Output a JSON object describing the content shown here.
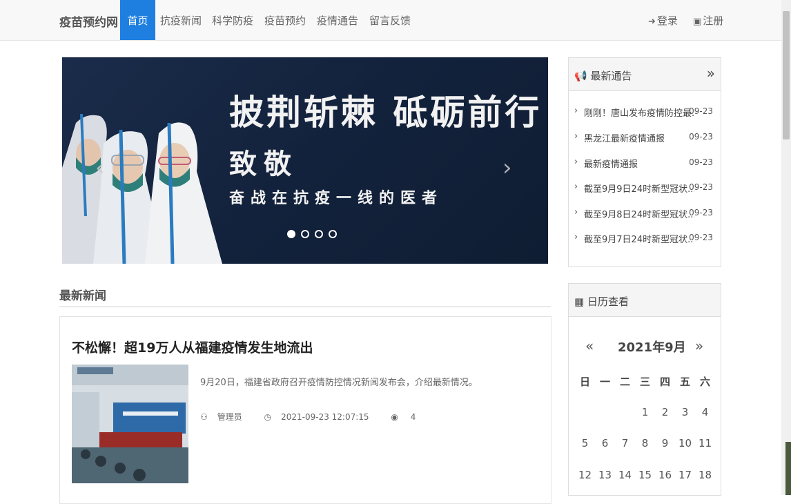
{
  "nav": {
    "brand": "疫苗预约网",
    "items": [
      "首页",
      "抗疫新闻",
      "科学防疫",
      "疫苗预约",
      "疫情通告",
      "留言反馈"
    ],
    "active_index": 0,
    "login": "登录",
    "register": "注册"
  },
  "banner": {
    "title": "披荆斩棘  砥砺前行",
    "subtitle": "致敬",
    "tagline": "奋战在抗疫一线的医者",
    "slide_count": 4,
    "active_slide": 0
  },
  "news": {
    "section_title": "最新新闻",
    "items": [
      {
        "title": "不松懈！超19万人从福建疫情发生地流出",
        "summary": "9月20日，福建省政府召开疫情防控情况新闻发布会，介绍最新情况。",
        "author": "管理员",
        "datetime": "2021-09-23 12:07:15",
        "views": "4"
      }
    ]
  },
  "notices": {
    "title": "最新通告",
    "more": "»",
    "items": [
      {
        "text": "刚刚！唐山发布疫情防控最...",
        "date": "09-23"
      },
      {
        "text": "黑龙江最新疫情通报",
        "date": "09-23"
      },
      {
        "text": "最新疫情通报",
        "date": "09-23"
      },
      {
        "text": "截至9月9日24时新型冠状...",
        "date": "09-23"
      },
      {
        "text": "截至9月8日24时新型冠状...",
        "date": "09-23"
      },
      {
        "text": "截至9月7日24时新型冠状...",
        "date": "09-23"
      }
    ]
  },
  "calendar": {
    "title": "日历查看",
    "month_label": "2021年9月",
    "prev": "«",
    "next": "»",
    "weekdays": [
      "日",
      "一",
      "二",
      "三",
      "四",
      "五",
      "六"
    ],
    "rows": [
      [
        "",
        "",
        "",
        "1",
        "2",
        "3",
        "4"
      ],
      [
        "5",
        "6",
        "7",
        "8",
        "9",
        "10",
        "11"
      ],
      [
        "12",
        "13",
        "14",
        "15",
        "16",
        "17",
        "18"
      ]
    ]
  },
  "colors": {
    "accent": "#1e7fe0",
    "banner_bg": "#13223c"
  }
}
